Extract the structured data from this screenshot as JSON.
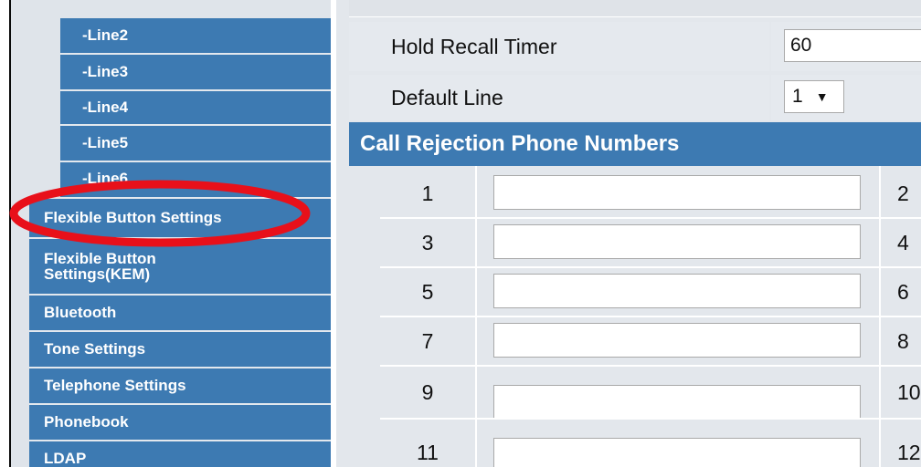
{
  "nav": {
    "sub_items": [
      "-Line2",
      "-Line3",
      "-Line4",
      "-Line5",
      "-Line6"
    ],
    "items": [
      "Flexible Button Settings",
      "Flexible Button Settings(KEM)",
      "Bluetooth",
      "Tone Settings",
      "Telephone Settings",
      "Phonebook",
      "LDAP"
    ]
  },
  "settings": {
    "hold_recall_timer": {
      "label": "Hold Recall Timer",
      "value": "60"
    },
    "default_line": {
      "label": "Default Line",
      "value": "1",
      "arrow": "▼"
    }
  },
  "rejection": {
    "title": "Call Rejection Phone Numbers",
    "rows": [
      {
        "left": "1",
        "right": "2"
      },
      {
        "left": "3",
        "right": "4"
      },
      {
        "left": "5",
        "right": "6"
      },
      {
        "left": "7",
        "right": "8"
      },
      {
        "left": "9",
        "right": "10"
      },
      {
        "left": "11",
        "right": "12"
      }
    ]
  },
  "highlight_color": "#e8101a"
}
